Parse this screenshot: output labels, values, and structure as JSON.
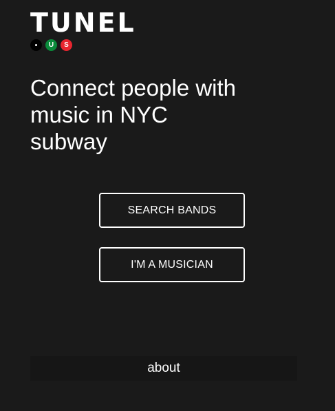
{
  "brand": {
    "name": "TUNEL",
    "badges": [
      {
        "icon": "dot-icon",
        "color": "#000000"
      },
      {
        "label": "U",
        "color": "#0a8a3a"
      },
      {
        "label": "S",
        "color": "#e8252f"
      }
    ]
  },
  "hero": {
    "headline": "Connect people with music in NYC subway"
  },
  "actions": {
    "search_label": "SEARCH BANDS",
    "musician_label": "I'M A MUSICIAN"
  },
  "footer": {
    "about_label": "about"
  },
  "colors": {
    "background": "#1a1a1a",
    "text": "#ffffff",
    "badge_u": "#0a8a3a",
    "badge_s": "#e8252f"
  }
}
